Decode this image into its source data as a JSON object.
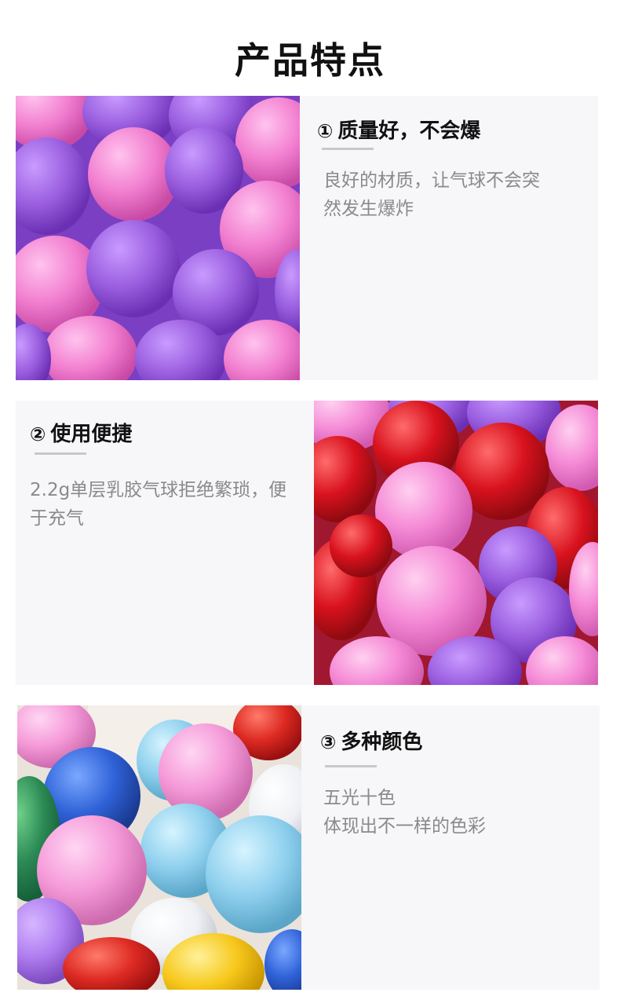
{
  "page": {
    "title": "产品特点"
  },
  "features": [
    {
      "number": "①",
      "title": "质量好，不会爆",
      "lines": [
        "良好的材质，让气球不会突",
        "然发生爆炸"
      ]
    },
    {
      "number": "②",
      "title": "使用便捷",
      "lines": [
        "2.2g单层乳胶气球拒绝繁琐，便",
        "于充气"
      ]
    },
    {
      "number": "③",
      "title": "多种颜色",
      "lines": [
        "五光十色",
        "体现出不一样的色彩"
      ]
    }
  ],
  "colors": {
    "panel_bg": "#f7f6f9",
    "title": "#111111",
    "desc": "#8a8a8a",
    "underline": "#c9c7cc",
    "balloon_purple": "#9b5fe0",
    "balloon_pink": "#f27fd0",
    "balloon_red": "#d8121e",
    "balloon_blue": "#2f62d8"
  }
}
